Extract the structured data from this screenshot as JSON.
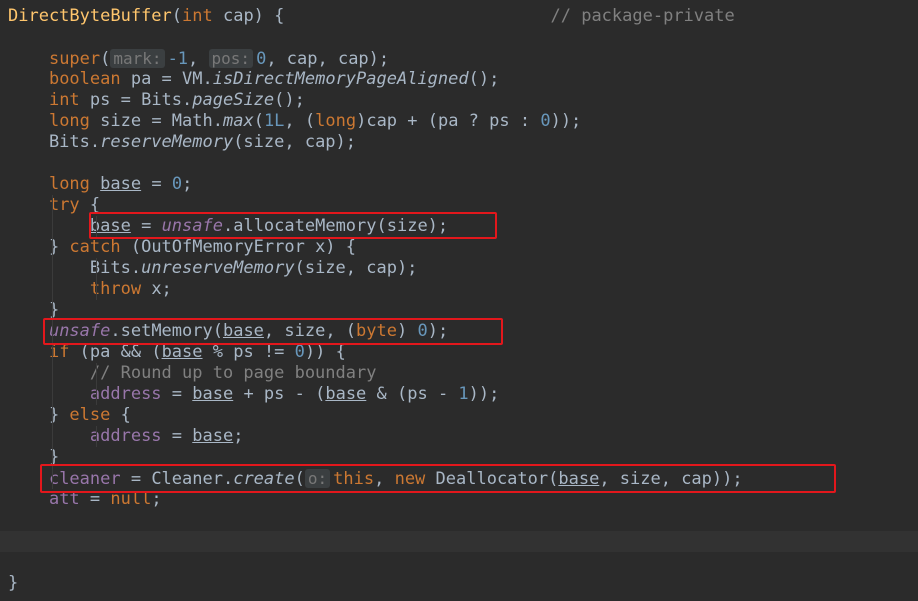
{
  "colors": {
    "background": "#2b2b2b",
    "text": "#a9b7c6",
    "keyword": "#cc7832",
    "function_decl": "#ffc66d",
    "number": "#6897bb",
    "comment": "#808080",
    "field": "#9876aa",
    "highlight_box": "#e3171c"
  },
  "lines": [
    {
      "tokens": [
        {
          "t": "DirectByteBuffer",
          "c": "fn"
        },
        {
          "t": "("
        },
        {
          "t": "int",
          "c": "kw"
        },
        {
          "t": " cap) {                          "
        },
        {
          "t": "// package-private",
          "c": "cmt"
        }
      ]
    },
    {
      "tokens": []
    },
    {
      "tokens": [
        {
          "t": "    "
        },
        {
          "t": "super",
          "c": "kw"
        },
        {
          "t": "("
        },
        {
          "t": "mark:",
          "c": "hint"
        },
        {
          "t": "-1",
          "c": "num"
        },
        {
          "t": ", "
        },
        {
          "t": "pos:",
          "c": "hint"
        },
        {
          "t": "0",
          "c": "num"
        },
        {
          "t": ", cap, cap);"
        }
      ]
    },
    {
      "tokens": [
        {
          "t": "    "
        },
        {
          "t": "boolean",
          "c": "kw"
        },
        {
          "t": " pa = VM."
        },
        {
          "t": "isDirectMemoryPageAligned",
          "c": "it"
        },
        {
          "t": "();"
        }
      ]
    },
    {
      "tokens": [
        {
          "t": "    "
        },
        {
          "t": "int",
          "c": "kw"
        },
        {
          "t": " ps = Bits."
        },
        {
          "t": "pageSize",
          "c": "it"
        },
        {
          "t": "();"
        }
      ]
    },
    {
      "tokens": [
        {
          "t": "    "
        },
        {
          "t": "long",
          "c": "kw"
        },
        {
          "t": " size = Math."
        },
        {
          "t": "max",
          "c": "it"
        },
        {
          "t": "("
        },
        {
          "t": "1L",
          "c": "num"
        },
        {
          "t": ", ("
        },
        {
          "t": "long",
          "c": "kw"
        },
        {
          "t": ")cap + (pa ? ps : "
        },
        {
          "t": "0",
          "c": "num"
        },
        {
          "t": "));"
        }
      ]
    },
    {
      "tokens": [
        {
          "t": "    Bits."
        },
        {
          "t": "reserveMemory",
          "c": "it"
        },
        {
          "t": "(size, cap);"
        }
      ]
    },
    {
      "tokens": []
    },
    {
      "tokens": [
        {
          "t": "    "
        },
        {
          "t": "long",
          "c": "kw"
        },
        {
          "t": " "
        },
        {
          "t": "base",
          "c": "var"
        },
        {
          "t": " = "
        },
        {
          "t": "0",
          "c": "num"
        },
        {
          "t": ";"
        }
      ]
    },
    {
      "tokens": [
        {
          "t": "    "
        },
        {
          "t": "try",
          "c": "kw"
        },
        {
          "t": " {"
        }
      ]
    },
    {
      "tokens": [
        {
          "t": "        "
        },
        {
          "t": "base",
          "c": "var"
        },
        {
          "t": " = "
        },
        {
          "t": "unsafe",
          "c": "fld it"
        },
        {
          "t": ".allocateMemory(size);"
        }
      ]
    },
    {
      "tokens": [
        {
          "t": "    } "
        },
        {
          "t": "catch",
          "c": "kw"
        },
        {
          "t": " (OutOfMemoryError x) {"
        }
      ]
    },
    {
      "tokens": [
        {
          "t": "        Bits."
        },
        {
          "t": "unreserveMemory",
          "c": "it"
        },
        {
          "t": "(size, cap);"
        }
      ]
    },
    {
      "tokens": [
        {
          "t": "        "
        },
        {
          "t": "throw",
          "c": "kw"
        },
        {
          "t": " x;"
        }
      ]
    },
    {
      "tokens": [
        {
          "t": "    }"
        }
      ]
    },
    {
      "tokens": [
        {
          "t": "    "
        },
        {
          "t": "unsafe",
          "c": "fld it"
        },
        {
          "t": ".setMemory("
        },
        {
          "t": "base",
          "c": "var"
        },
        {
          "t": ", size, ("
        },
        {
          "t": "byte",
          "c": "kw"
        },
        {
          "t": ") "
        },
        {
          "t": "0",
          "c": "num"
        },
        {
          "t": ");"
        }
      ]
    },
    {
      "tokens": [
        {
          "t": "    "
        },
        {
          "t": "if",
          "c": "kw"
        },
        {
          "t": " (pa && ("
        },
        {
          "t": "base",
          "c": "var"
        },
        {
          "t": " % ps != "
        },
        {
          "t": "0",
          "c": "num"
        },
        {
          "t": ")) {"
        }
      ]
    },
    {
      "tokens": [
        {
          "t": "        "
        },
        {
          "t": "// Round up to page boundary",
          "c": "cmt"
        }
      ]
    },
    {
      "tokens": [
        {
          "t": "        "
        },
        {
          "t": "address",
          "c": "fld"
        },
        {
          "t": " = "
        },
        {
          "t": "base",
          "c": "var"
        },
        {
          "t": " + ps - ("
        },
        {
          "t": "base",
          "c": "var"
        },
        {
          "t": " & (ps - "
        },
        {
          "t": "1",
          "c": "num"
        },
        {
          "t": "));"
        }
      ]
    },
    {
      "tokens": [
        {
          "t": "    } "
        },
        {
          "t": "else",
          "c": "kw"
        },
        {
          "t": " {"
        }
      ]
    },
    {
      "tokens": [
        {
          "t": "        "
        },
        {
          "t": "address",
          "c": "fld"
        },
        {
          "t": " = "
        },
        {
          "t": "base",
          "c": "var"
        },
        {
          "t": ";"
        }
      ]
    },
    {
      "tokens": [
        {
          "t": "    }"
        }
      ]
    },
    {
      "tokens": [
        {
          "t": "    "
        },
        {
          "t": "cleaner",
          "c": "fld"
        },
        {
          "t": " = Cleaner."
        },
        {
          "t": "create",
          "c": "it"
        },
        {
          "t": "("
        },
        {
          "t": "o:",
          "c": "hint"
        },
        {
          "t": "this",
          "c": "kw"
        },
        {
          "t": ", "
        },
        {
          "t": "new",
          "c": "kw"
        },
        {
          "t": " Deallocator("
        },
        {
          "t": "base",
          "c": "var"
        },
        {
          "t": ", size, cap));"
        }
      ]
    },
    {
      "tokens": [
        {
          "t": "    "
        },
        {
          "t": "att",
          "c": "fld"
        },
        {
          "t": " = "
        },
        {
          "t": "null",
          "c": "kw"
        },
        {
          "t": ";"
        }
      ]
    },
    {
      "tokens": []
    },
    {
      "tokens": []
    },
    {
      "tokens": []
    },
    {
      "tokens": [
        {
          "t": "}"
        }
      ]
    }
  ]
}
